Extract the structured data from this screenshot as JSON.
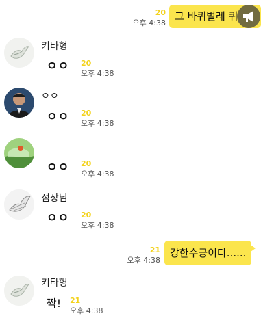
{
  "messages": [
    {
      "id": "m1",
      "direction": "out",
      "text": "그 바퀴벌레 퀴",
      "unread": "20",
      "time": "오후 4:38"
    },
    {
      "id": "m2",
      "direction": "in",
      "sender": "키타형",
      "avatar_icon": "dove-icon",
      "text": "ㅇㅇ",
      "unread": "20",
      "time": "오후 4:38"
    },
    {
      "id": "m3",
      "direction": "in",
      "sender": "ㅇㅇ",
      "avatar_icon": "man-photo",
      "text": "ㅇㅇ",
      "unread": "20",
      "time": "오후 4:38"
    },
    {
      "id": "m4",
      "direction": "in",
      "sender": "",
      "avatar_icon": "landscape-photo",
      "text": "ㅇㅇ",
      "unread": "20",
      "time": "오후 4:38"
    },
    {
      "id": "m5",
      "direction": "in",
      "sender": "점장님",
      "avatar_icon": "bird-sketch-icon",
      "text": "ㅇㅇ",
      "unread": "20",
      "time": "오후 4:38"
    },
    {
      "id": "m6",
      "direction": "out",
      "text": "강한수긍이다......",
      "unread": "21",
      "time": "오후 4:38"
    },
    {
      "id": "m7",
      "direction": "in",
      "sender": "키타형",
      "avatar_icon": "dove-icon",
      "text": "짝!",
      "unread": "21",
      "time": "오후 4:38"
    }
  ],
  "overlay": {
    "icon": "megaphone-icon"
  },
  "colors": {
    "bubble_out": "#fbe54d",
    "unread": "#f3d21b",
    "bubble_in": "#ffffff"
  }
}
